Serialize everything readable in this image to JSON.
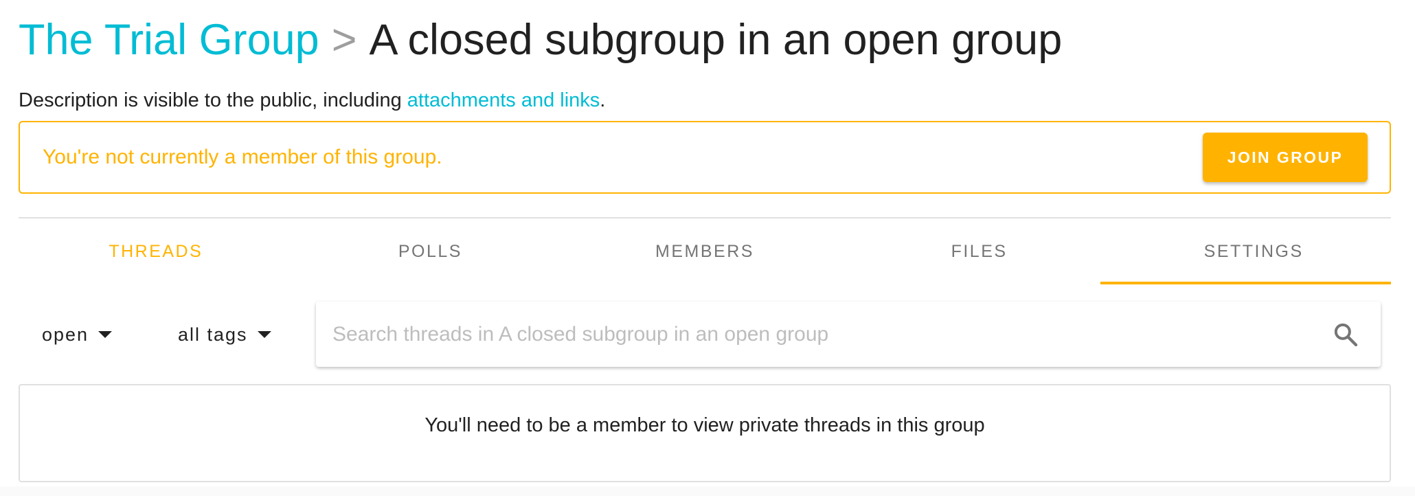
{
  "breadcrumb": {
    "parent": "The Trial Group",
    "separator": ">",
    "current": "A closed subgroup in an open group"
  },
  "description": {
    "prefix": "Description is visible to the public, including ",
    "link": "attachments and links",
    "suffix": "."
  },
  "notice": {
    "text": "You're not currently a member of this group.",
    "button_label": "JOIN GROUP"
  },
  "tabs": [
    {
      "label": "THREADS",
      "active": true
    },
    {
      "label": "POLLS",
      "active": false
    },
    {
      "label": "MEMBERS",
      "active": false
    },
    {
      "label": "FILES",
      "active": false
    },
    {
      "label": "SETTINGS",
      "active": false
    }
  ],
  "filters": {
    "status": "open",
    "tags": "all tags"
  },
  "search": {
    "placeholder": "Search threads in A closed subgroup in an open group",
    "value": ""
  },
  "empty_state": {
    "message": "You'll need to be a member to view private threads in this group"
  },
  "colors": {
    "link": "#00bcd4",
    "accent": "#ffb300",
    "text": "#212121",
    "muted": "#757575"
  }
}
